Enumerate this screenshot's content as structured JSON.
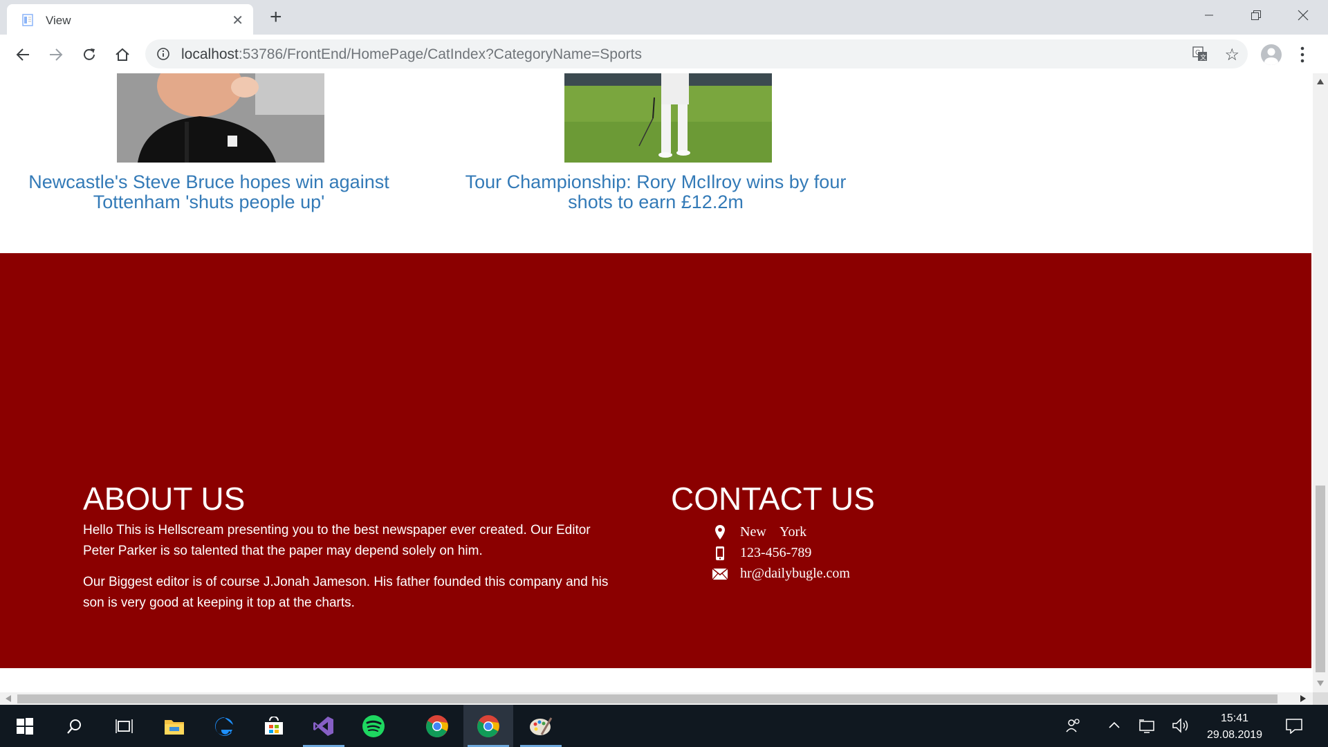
{
  "browser": {
    "tab_title": "View",
    "url_host": "localhost",
    "url_rest": ":53786/FrontEnd/HomePage/CatIndex?CategoryName=Sports"
  },
  "articles": [
    {
      "title": "Newcastle's Steve Bruce hopes win against Tottenham 'shuts people up'"
    },
    {
      "title": "Tour Championship: Rory McIlroy wins by four shots to earn £12.2m"
    }
  ],
  "footer": {
    "about_heading": "ABOUT US",
    "about_p1": "Hello This is Hellscream presenting you to the best newspaper ever created. Our Editor Peter Parker is so talented that the paper may depend solely on him.",
    "about_p2": "Our Biggest editor is of course J.Jonah Jameson. His father founded this company and his son is very good at keeping it top at the charts.",
    "contact_heading": "CONTACT US",
    "location": "New    York",
    "phone": "123-456-789",
    "email": "hr@dailybugle.com"
  },
  "taskbar": {
    "time": "15:41",
    "date": "29.08.2019"
  },
  "colors": {
    "footer_bg": "#8b0000",
    "link": "#337ab7"
  }
}
